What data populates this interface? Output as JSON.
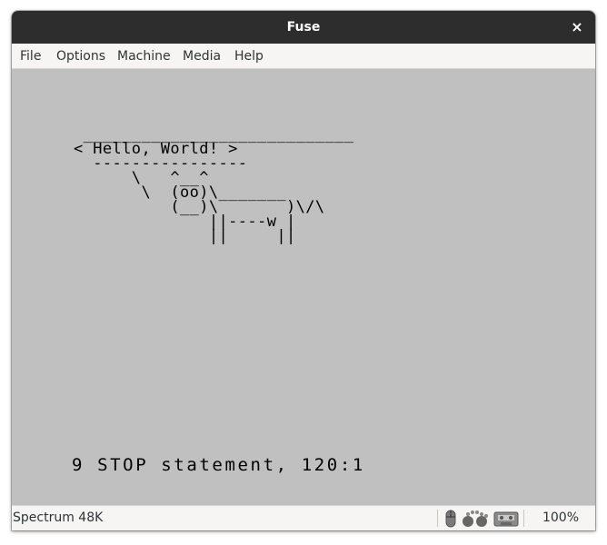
{
  "window": {
    "title": "Fuse",
    "close_glyph": "×"
  },
  "menu": {
    "items": [
      {
        "label": "File"
      },
      {
        "label": "Options"
      },
      {
        "label": "Machine"
      },
      {
        "label": "Media"
      },
      {
        "label": "Help"
      }
    ]
  },
  "screen": {
    "art": " ____________________________\n< Hello, World! >\n  ----------------\n      \\   ^__^\n       \\  (oo)\\_______\n          (__)\\       )\\/\\\n              ||----w |\n              ||     ||",
    "status_message": "9 STOP statement, 120:1"
  },
  "statusbar": {
    "machine": "Spectrum 48K",
    "icons": [
      "mouse-icon",
      "joystick-icon",
      "tape-icon"
    ],
    "zoom": "100%"
  },
  "colors": {
    "titlebar": "#2d2d2d",
    "screen_paper": "#c0c0c0",
    "screen_ink": "#000000",
    "menubar": "#f6f5f4"
  }
}
